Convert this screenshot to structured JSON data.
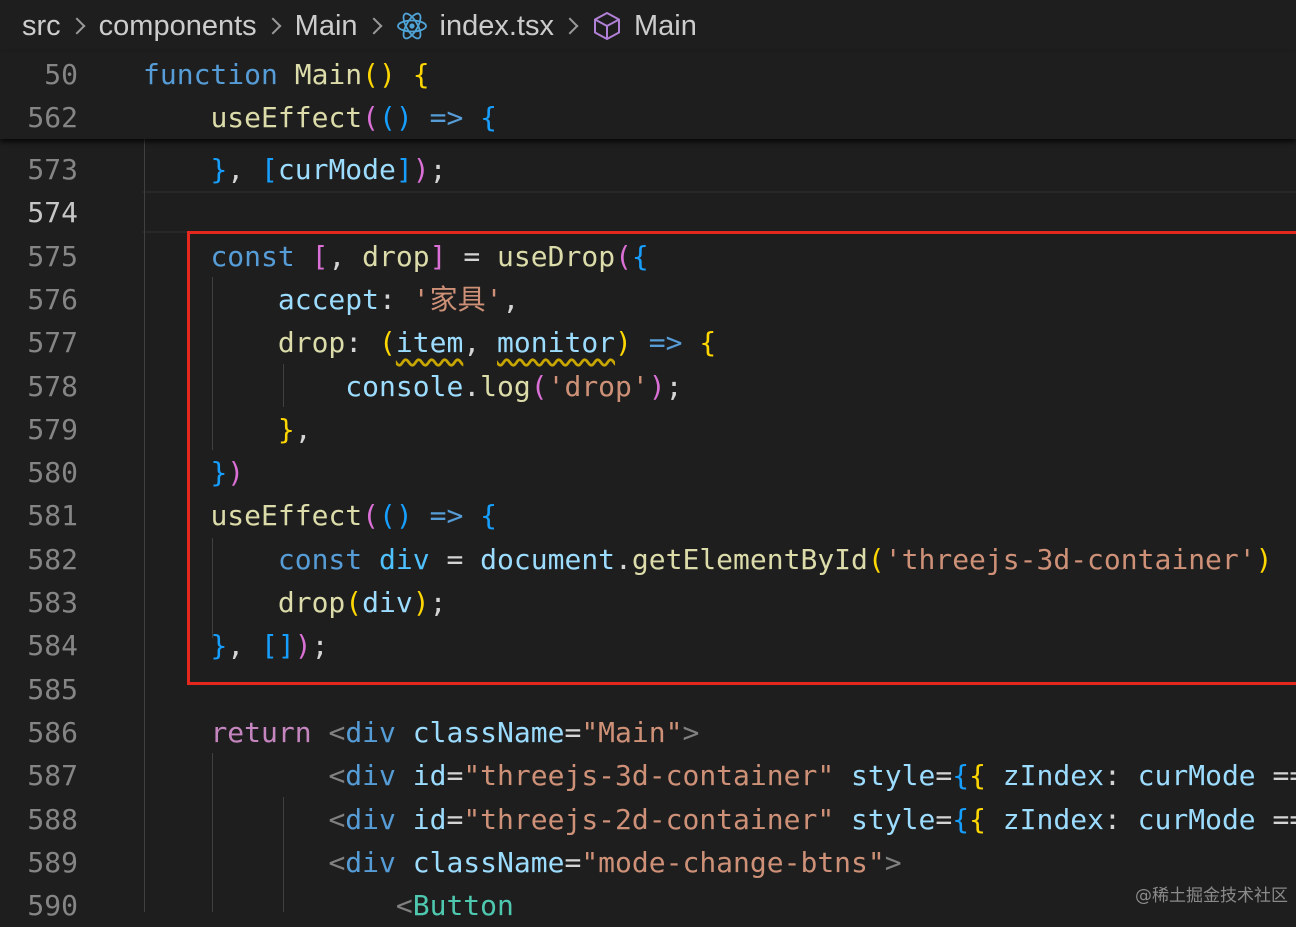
{
  "breadcrumb": {
    "items": [
      "src",
      "components",
      "Main",
      "index.tsx",
      "Main"
    ],
    "icons": [
      "react-icon",
      "symbol-method-icon"
    ]
  },
  "sticky_lines": [
    {
      "num": "50",
      "segments": [
        [
          "kw",
          "function"
        ],
        [
          "p",
          " "
        ],
        [
          "fn",
          "Main"
        ],
        [
          "b1",
          "()"
        ],
        [
          "p",
          " "
        ],
        [
          "b1",
          "{"
        ]
      ]
    },
    {
      "num": "562",
      "segments": [
        [
          "p",
          "    "
        ],
        [
          "fn",
          "useEffect"
        ],
        [
          "b2",
          "("
        ],
        [
          "b3",
          "()"
        ],
        [
          "p",
          " "
        ],
        [
          "kw",
          "=>"
        ],
        [
          "p",
          " "
        ],
        [
          "b3",
          "{"
        ]
      ]
    }
  ],
  "lines": [
    {
      "num": "573",
      "segments": [
        [
          "p",
          "    "
        ],
        [
          "b3",
          "}"
        ],
        [
          "p",
          ", "
        ],
        [
          "b3",
          "["
        ],
        [
          "var",
          "curMode"
        ],
        [
          "b3",
          "]"
        ],
        [
          "b2",
          ")"
        ],
        [
          "p",
          ";"
        ]
      ]
    },
    {
      "num": "574",
      "current": true,
      "segments": []
    },
    {
      "num": "575",
      "segments": [
        [
          "p",
          "    "
        ],
        [
          "kw",
          "const"
        ],
        [
          "p",
          " "
        ],
        [
          "b2",
          "["
        ],
        [
          "p",
          ", "
        ],
        [
          "fn",
          "drop"
        ],
        [
          "b2",
          "]"
        ],
        [
          "p",
          " = "
        ],
        [
          "fn",
          "useDrop"
        ],
        [
          "b2",
          "("
        ],
        [
          "b3",
          "{"
        ]
      ]
    },
    {
      "num": "576",
      "segments": [
        [
          "p",
          "        "
        ],
        [
          "var",
          "accept"
        ],
        [
          "p",
          ": "
        ],
        [
          "str",
          "'家具'"
        ],
        [
          "p",
          ","
        ]
      ]
    },
    {
      "num": "577",
      "segments": [
        [
          "p",
          "        "
        ],
        [
          "fn",
          "drop"
        ],
        [
          "p",
          ": "
        ],
        [
          "b1",
          "("
        ],
        [
          "var sq",
          "item"
        ],
        [
          "p",
          ", "
        ],
        [
          "var sq",
          "monitor"
        ],
        [
          "b1",
          ")"
        ],
        [
          "p",
          " "
        ],
        [
          "kw",
          "=>"
        ],
        [
          "p",
          " "
        ],
        [
          "b1",
          "{"
        ]
      ]
    },
    {
      "num": "578",
      "segments": [
        [
          "p",
          "            "
        ],
        [
          "var",
          "console"
        ],
        [
          "p",
          "."
        ],
        [
          "fn",
          "log"
        ],
        [
          "b2",
          "("
        ],
        [
          "str",
          "'drop'"
        ],
        [
          "b2",
          ")"
        ],
        [
          "p",
          ";"
        ]
      ]
    },
    {
      "num": "579",
      "segments": [
        [
          "p",
          "        "
        ],
        [
          "b1",
          "}"
        ],
        [
          "p",
          ","
        ]
      ]
    },
    {
      "num": "580",
      "segments": [
        [
          "p",
          "    "
        ],
        [
          "b3",
          "}"
        ],
        [
          "b2",
          ")"
        ]
      ]
    },
    {
      "num": "581",
      "segments": [
        [
          "p",
          "    "
        ],
        [
          "fn",
          "useEffect"
        ],
        [
          "b2",
          "("
        ],
        [
          "b3",
          "()"
        ],
        [
          "p",
          " "
        ],
        [
          "kw",
          "=>"
        ],
        [
          "p",
          " "
        ],
        [
          "b3",
          "{"
        ]
      ]
    },
    {
      "num": "582",
      "segments": [
        [
          "p",
          "        "
        ],
        [
          "kw",
          "const"
        ],
        [
          "p",
          " "
        ],
        [
          "cst",
          "div"
        ],
        [
          "p",
          " = "
        ],
        [
          "var",
          "document"
        ],
        [
          "p",
          "."
        ],
        [
          "fn",
          "getElementById"
        ],
        [
          "b1",
          "("
        ],
        [
          "str",
          "'threejs-3d-container'"
        ],
        [
          "b1",
          ")"
        ]
      ]
    },
    {
      "num": "583",
      "segments": [
        [
          "p",
          "        "
        ],
        [
          "fn",
          "drop"
        ],
        [
          "b1",
          "("
        ],
        [
          "var",
          "div"
        ],
        [
          "b1",
          ")"
        ],
        [
          "p",
          ";"
        ]
      ]
    },
    {
      "num": "584",
      "segments": [
        [
          "p",
          "    "
        ],
        [
          "b3",
          "}"
        ],
        [
          "p",
          ", "
        ],
        [
          "b3",
          "[]"
        ],
        [
          "b2",
          ")"
        ],
        [
          "p",
          ";"
        ]
      ]
    },
    {
      "num": "585",
      "segments": []
    },
    {
      "num": "586",
      "segments": [
        [
          "p",
          "    "
        ],
        [
          "ctl",
          "return"
        ],
        [
          "p",
          " "
        ],
        [
          "tagp",
          "<"
        ],
        [
          "tag",
          "div"
        ],
        [
          "p",
          " "
        ],
        [
          "var",
          "className"
        ],
        [
          "p",
          "="
        ],
        [
          "str",
          "\"Main\""
        ],
        [
          "tagp",
          ">"
        ]
      ]
    },
    {
      "num": "587",
      "segments": [
        [
          "p",
          "           "
        ],
        [
          "tagp",
          "<"
        ],
        [
          "tag",
          "div"
        ],
        [
          "p",
          " "
        ],
        [
          "var",
          "id"
        ],
        [
          "p",
          "="
        ],
        [
          "str",
          "\"threejs-3d-container\""
        ],
        [
          "p",
          " "
        ],
        [
          "var",
          "style"
        ],
        [
          "p",
          "="
        ],
        [
          "b3",
          "{"
        ],
        [
          "b1",
          "{"
        ],
        [
          "p",
          " "
        ],
        [
          "var",
          "zIndex"
        ],
        [
          "p",
          ": "
        ],
        [
          "var",
          "curMode"
        ],
        [
          "p",
          " =="
        ]
      ]
    },
    {
      "num": "588",
      "segments": [
        [
          "p",
          "           "
        ],
        [
          "tagp",
          "<"
        ],
        [
          "tag",
          "div"
        ],
        [
          "p",
          " "
        ],
        [
          "var",
          "id"
        ],
        [
          "p",
          "="
        ],
        [
          "str",
          "\"threejs-2d-container\""
        ],
        [
          "p",
          " "
        ],
        [
          "var",
          "style"
        ],
        [
          "p",
          "="
        ],
        [
          "b3",
          "{"
        ],
        [
          "b1",
          "{"
        ],
        [
          "p",
          " "
        ],
        [
          "var",
          "zIndex"
        ],
        [
          "p",
          ": "
        ],
        [
          "var",
          "curMode"
        ],
        [
          "p",
          " =="
        ]
      ]
    },
    {
      "num": "589",
      "segments": [
        [
          "p",
          "           "
        ],
        [
          "tagp",
          "<"
        ],
        [
          "tag",
          "div"
        ],
        [
          "p",
          " "
        ],
        [
          "var",
          "className"
        ],
        [
          "p",
          "="
        ],
        [
          "str",
          "\"mode-change-btns\""
        ],
        [
          "tagp",
          ">"
        ]
      ]
    },
    {
      "num": "590",
      "segments": [
        [
          "p",
          "               "
        ],
        [
          "tagp",
          "<"
        ],
        [
          "comp",
          "Button"
        ]
      ]
    }
  ],
  "watermark": "@稀土掘金技术社区"
}
